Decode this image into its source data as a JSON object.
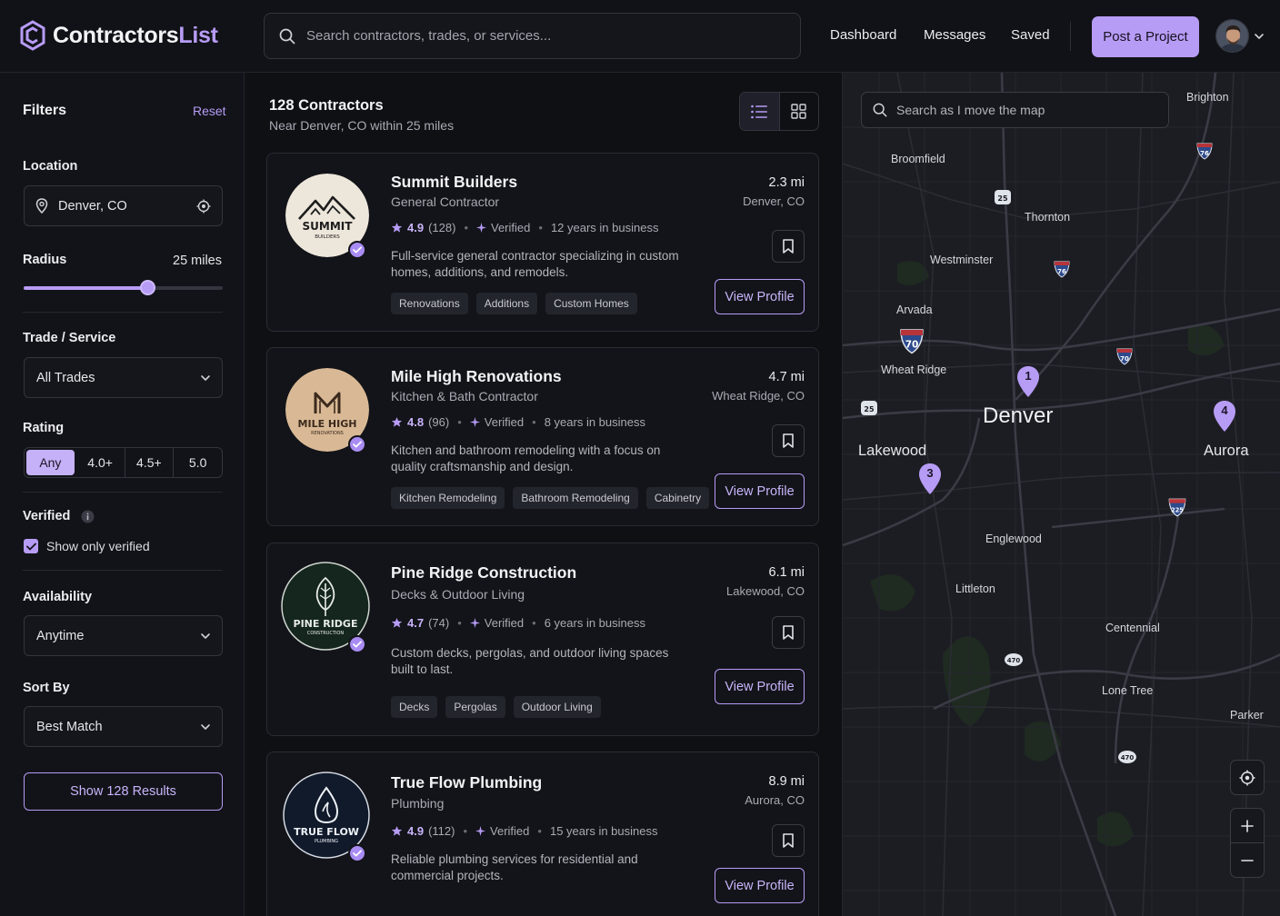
{
  "header": {
    "brand_main": "Contractors",
    "brand_accent": "List",
    "search_placeholder": "Search contractors, trades, or services...",
    "nav": [
      "Dashboard",
      "Messages",
      "Saved"
    ],
    "post_button": "Post a Project"
  },
  "filters": {
    "title": "Filters",
    "reset": "Reset",
    "location_label": "Location",
    "location_value": "Denver, CO",
    "radius_label": "Radius",
    "radius_value": "25 miles",
    "radius_fraction": 0.62,
    "trade_label": "Trade / Service",
    "trade_value": "All Trades",
    "rating_label": "Rating",
    "rating_options": [
      "Any",
      "4.0+",
      "4.5+",
      "5.0"
    ],
    "verified_label": "Verified",
    "verified_checkbox": "Show only verified",
    "availability_label": "Availability",
    "availability_value": "Anytime",
    "sort_label": "Sort By",
    "sort_value": "Best Match",
    "show_button": "Show 128 Results"
  },
  "results": {
    "count": "128 Contractors",
    "subtitle": "Near Denver, CO within 25 miles",
    "view_button": "View Profile",
    "cards": [
      {
        "name": "Summit Builders",
        "type": "General Contractor",
        "rating": "4.9",
        "reviews": "(128)",
        "verified": "Verified",
        "years": "12 years in business",
        "description": "Full-service general contractor specializing in custom homes, additions, and remodels.",
        "tags": [
          "Renovations",
          "Additions",
          "Custom Homes"
        ],
        "distance": "2.3 mi",
        "city": "Denver, CO",
        "logo_line1": "SUMMIT",
        "logo_line2": "BUILDERS"
      },
      {
        "name": "Mile High Renovations",
        "type": "Kitchen & Bath Contractor",
        "rating": "4.8",
        "reviews": "(96)",
        "verified": "Verified",
        "years": "8 years in business",
        "description": "Kitchen and bathroom remodeling with a focus on quality craftsmanship and design.",
        "tags": [
          "Kitchen Remodeling",
          "Bathroom Remodeling",
          "Cabinetry"
        ],
        "distance": "4.7 mi",
        "city": "Wheat Ridge, CO",
        "logo_line1": "MILE HIGH",
        "logo_line2": "RENOVATIONS"
      },
      {
        "name": "Pine Ridge Construction",
        "type": "Decks & Outdoor Living",
        "rating": "4.7",
        "reviews": "(74)",
        "verified": "Verified",
        "years": "6 years in business",
        "description": "Custom decks, pergolas, and outdoor living spaces built to last.",
        "tags": [
          "Decks",
          "Pergolas",
          "Outdoor Living"
        ],
        "distance": "6.1 mi",
        "city": "Lakewood, CO",
        "logo_line1": "PINE RIDGE",
        "logo_line2": "CONSTRUCTION"
      },
      {
        "name": "True Flow Plumbing",
        "type": "Plumbing",
        "rating": "4.9",
        "reviews": "(112)",
        "verified": "Verified",
        "years": "15 years in business",
        "description": "Reliable plumbing services for residential and commercial projects.",
        "tags": [],
        "distance": "8.9 mi",
        "city": "Aurora, CO",
        "logo_line1": "TRUE FLOW",
        "logo_line2": "PLUMBING"
      }
    ]
  },
  "map": {
    "search_placeholder": "Search as I move the map",
    "places": [
      "Brighton",
      "Broomfield",
      "Thornton",
      "Westminster",
      "Arvada",
      "Wheat Ridge",
      "Denver",
      "Lakewood",
      "Aurora",
      "Englewood",
      "Littleton",
      "Centennial",
      "Lone Tree",
      "Parker"
    ],
    "pins": [
      "1",
      "3",
      "4"
    ],
    "shields": [
      "76",
      "25",
      "76",
      "70",
      "70",
      "25",
      "225",
      "470",
      "470"
    ]
  },
  "colors": {
    "accent": "#b79cf6",
    "background": "#0f1014",
    "panel": "#131419"
  }
}
